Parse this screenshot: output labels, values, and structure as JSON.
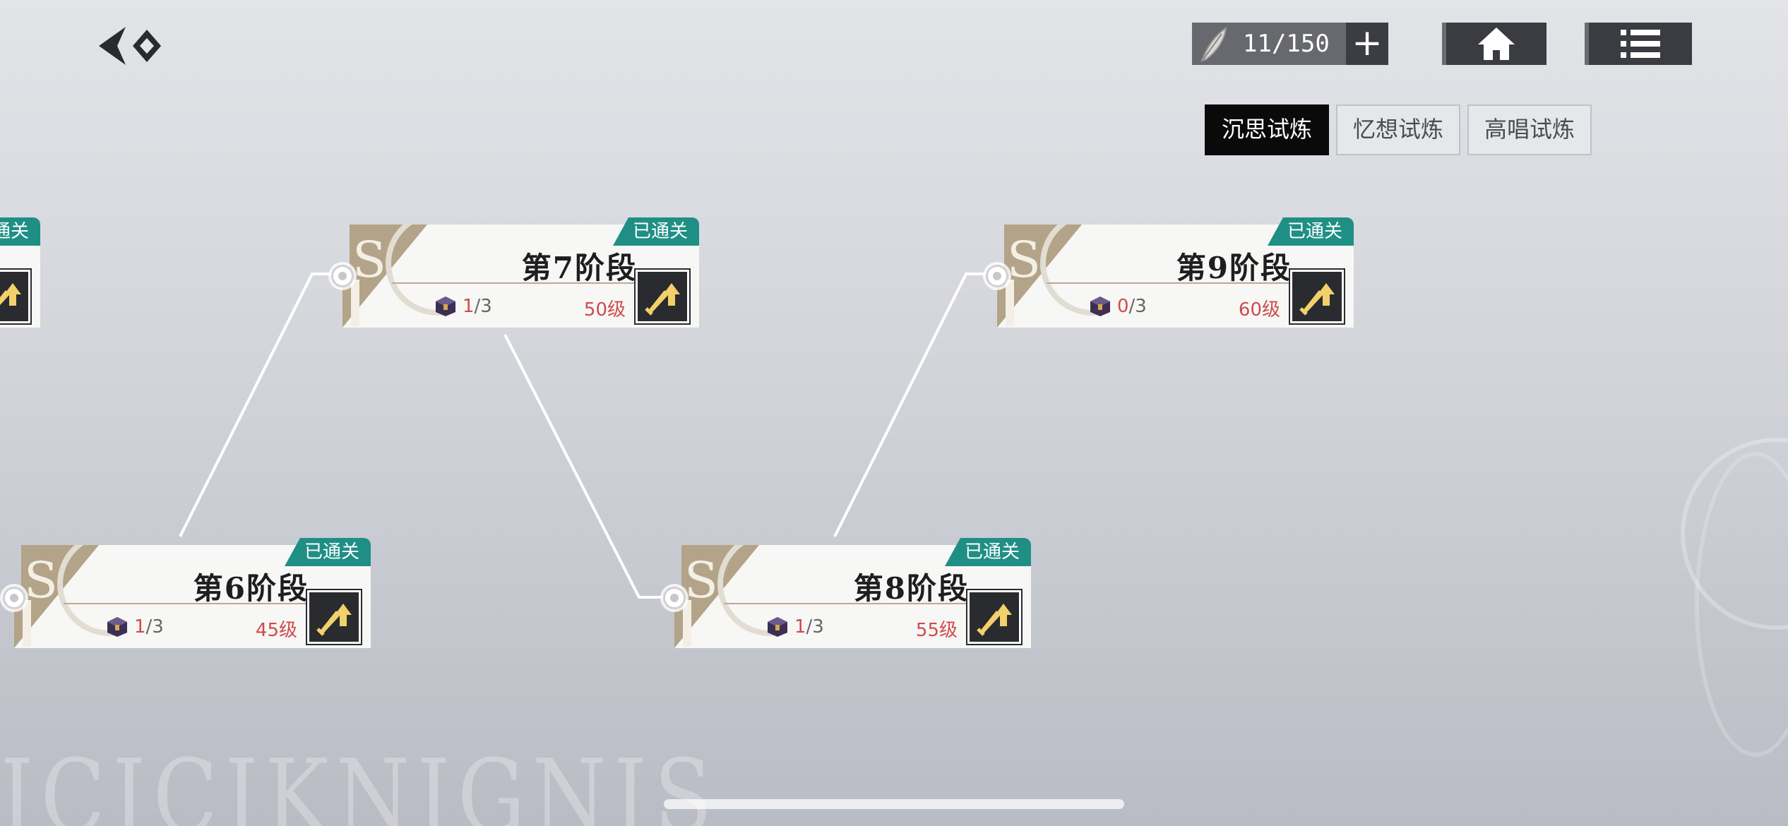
{
  "header": {
    "back_icon": "double-chevron-back-icon",
    "stamina": {
      "icon": "feather-quill-icon",
      "value": "11/150",
      "add_label": "+"
    },
    "home_icon": "home-icon",
    "menu_icon": "list-menu-icon"
  },
  "tabs": [
    {
      "label": "沉思试炼",
      "active": true
    },
    {
      "label": "忆想试炼",
      "active": false
    },
    {
      "label": "高唱试炼",
      "active": false
    }
  ],
  "stages": [
    {
      "id": "stage5-partial",
      "title": "",
      "status": "已通关",
      "progress_count": "",
      "progress_total": "",
      "level": ""
    },
    {
      "id": "stage6",
      "title": "第6阶段",
      "status": "已通关",
      "progress_count": "1",
      "progress_total": "/3",
      "level": "45级"
    },
    {
      "id": "stage7",
      "title": "第7阶段",
      "status": "已通关",
      "progress_count": "1",
      "progress_total": "/3",
      "level": "50级"
    },
    {
      "id": "stage8",
      "title": "第8阶段",
      "status": "已通关",
      "progress_count": "1",
      "progress_total": "/3",
      "level": "55级"
    },
    {
      "id": "stage9",
      "title": "第9阶段",
      "status": "已通关",
      "progress_count": "0",
      "progress_total": "/3",
      "level": "60级"
    }
  ],
  "colors": {
    "badge": "#1f8f86",
    "level": "#cf4c4c",
    "active_tab": "#0a0a0a"
  }
}
